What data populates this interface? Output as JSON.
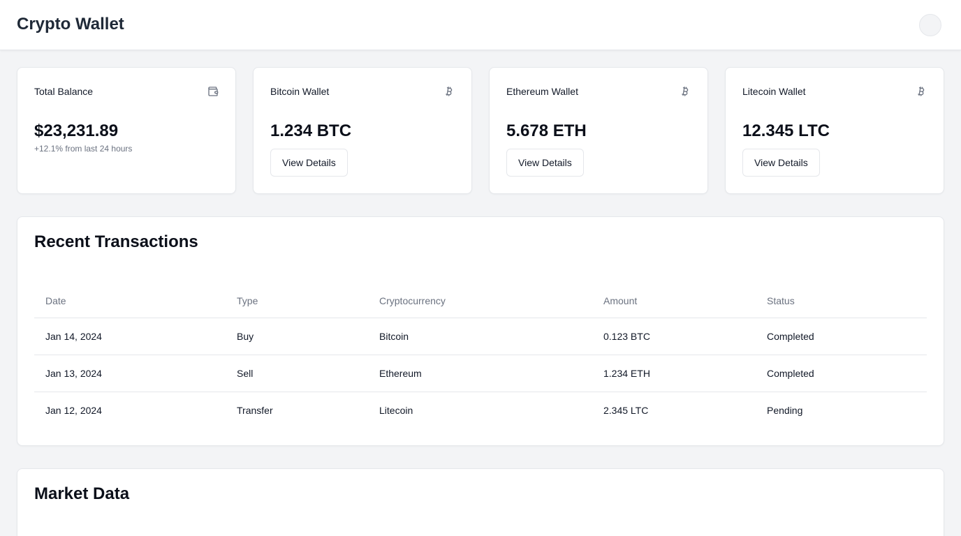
{
  "header": {
    "title": "Crypto Wallet",
    "avatar_icon": "user-avatar"
  },
  "stats": [
    {
      "title": "Total Balance",
      "icon": "wallet-icon",
      "value": "$23,231.89",
      "subtext": "+12.1% from last 24 hours"
    },
    {
      "title": "Bitcoin Wallet",
      "icon": "bitcoin-icon",
      "value": "1.234 BTC",
      "button": "View Details"
    },
    {
      "title": "Ethereum Wallet",
      "icon": "bitcoin-icon",
      "value": "5.678 ETH",
      "button": "View Details"
    },
    {
      "title": "Litecoin Wallet",
      "icon": "bitcoin-icon",
      "value": "12.345 LTC",
      "button": "View Details"
    }
  ],
  "transactions": {
    "title": "Recent Transactions",
    "columns": [
      "Date",
      "Type",
      "Cryptocurrency",
      "Amount",
      "Status"
    ],
    "rows": [
      [
        "Jan 14, 2024",
        "Buy",
        "Bitcoin",
        "0.123 BTC",
        "Completed"
      ],
      [
        "Jan 13, 2024",
        "Sell",
        "Ethereum",
        "1.234 ETH",
        "Completed"
      ],
      [
        "Jan 12, 2024",
        "Transfer",
        "Litecoin",
        "2.345 LTC",
        "Pending"
      ]
    ]
  },
  "market": {
    "title": "Market Data"
  },
  "colors": {
    "background": "#f3f4f6",
    "card": "#ffffff",
    "border": "#e5e7eb",
    "muted": "#6b7280"
  }
}
